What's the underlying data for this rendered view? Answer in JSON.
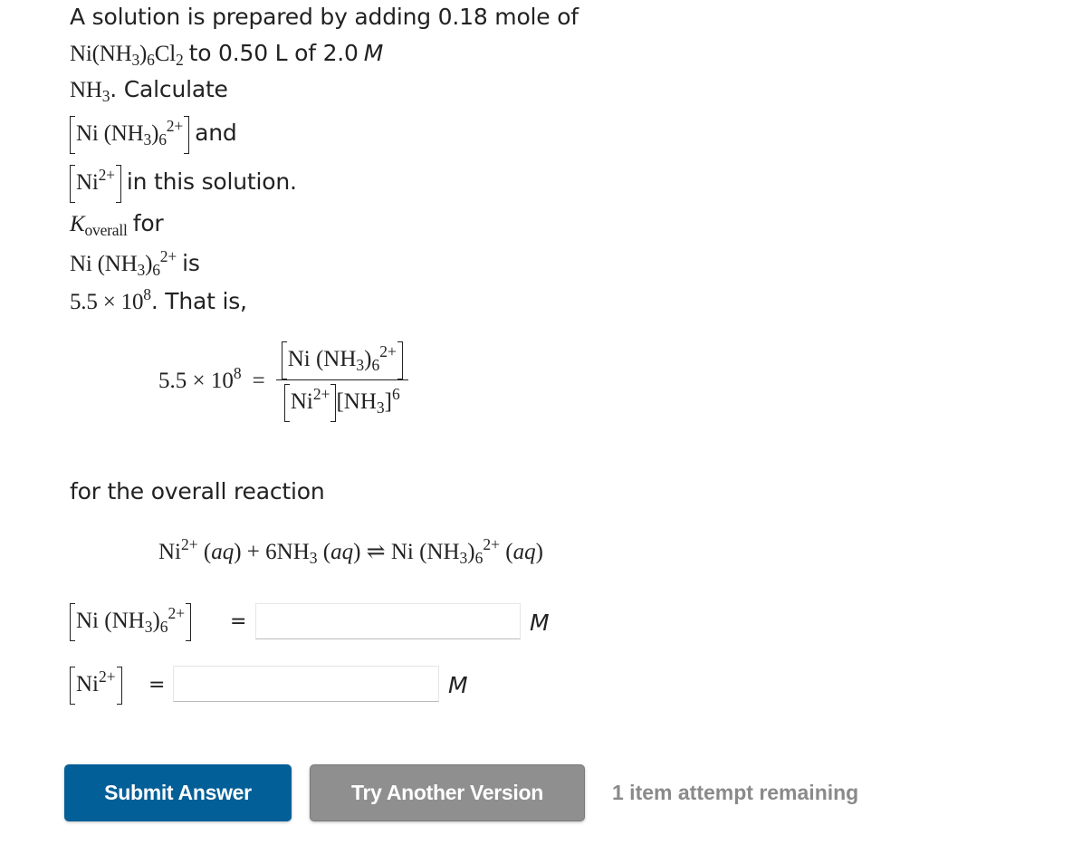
{
  "problem": {
    "line1": "A solution is prepared by adding 0.18 mole of",
    "line2_formula_salt": "Ni(NH3)6Cl2",
    "line2_text": "to 0.50 L of 2.0",
    "line2_unit": "M",
    "line3_formula": "NH3",
    "line3_text": ". Calculate",
    "line4_text": "and",
    "line5_text": "in this solution.",
    "line6_k_symbol": "K",
    "line6_k_sub": "overall",
    "line6_text": "for",
    "line7_text": "is",
    "line8_value": "5.5 × 10",
    "line8_exp": "8",
    "line8_text": ". That is,"
  },
  "equation": {
    "lhs_value": "5.5 × 10",
    "lhs_exp": "8",
    "equals": "="
  },
  "reaction_intro": "for the overall reaction",
  "reaction": {
    "reactant1": "Ni",
    "reactant1_charge": "2+",
    "phase": "aq",
    "plus": "+",
    "reactant2_coeff": "6NH",
    "arrow": "⇌",
    "product": "Ni"
  },
  "chem": {
    "ni": "Ni",
    "nh": "NH",
    "sub3": "3",
    "sub6": "6",
    "charge": "2+",
    "exp6": "6",
    "lparen": "(",
    "rparen": ")",
    "cl": "Cl",
    "sub2": "2"
  },
  "answers": {
    "complex_equals": "=",
    "complex_value": "",
    "complex_unit": "M",
    "ni_equals": "=",
    "ni_value": "",
    "ni_unit": "M"
  },
  "buttons": {
    "submit": "Submit Answer",
    "try_another": "Try Another Version"
  },
  "attempts_text": "1 item attempt remaining",
  "colors": {
    "submit_bg": "#035f97",
    "try_bg": "#8f8f8f",
    "attempts_text": "#8a8a8a"
  }
}
